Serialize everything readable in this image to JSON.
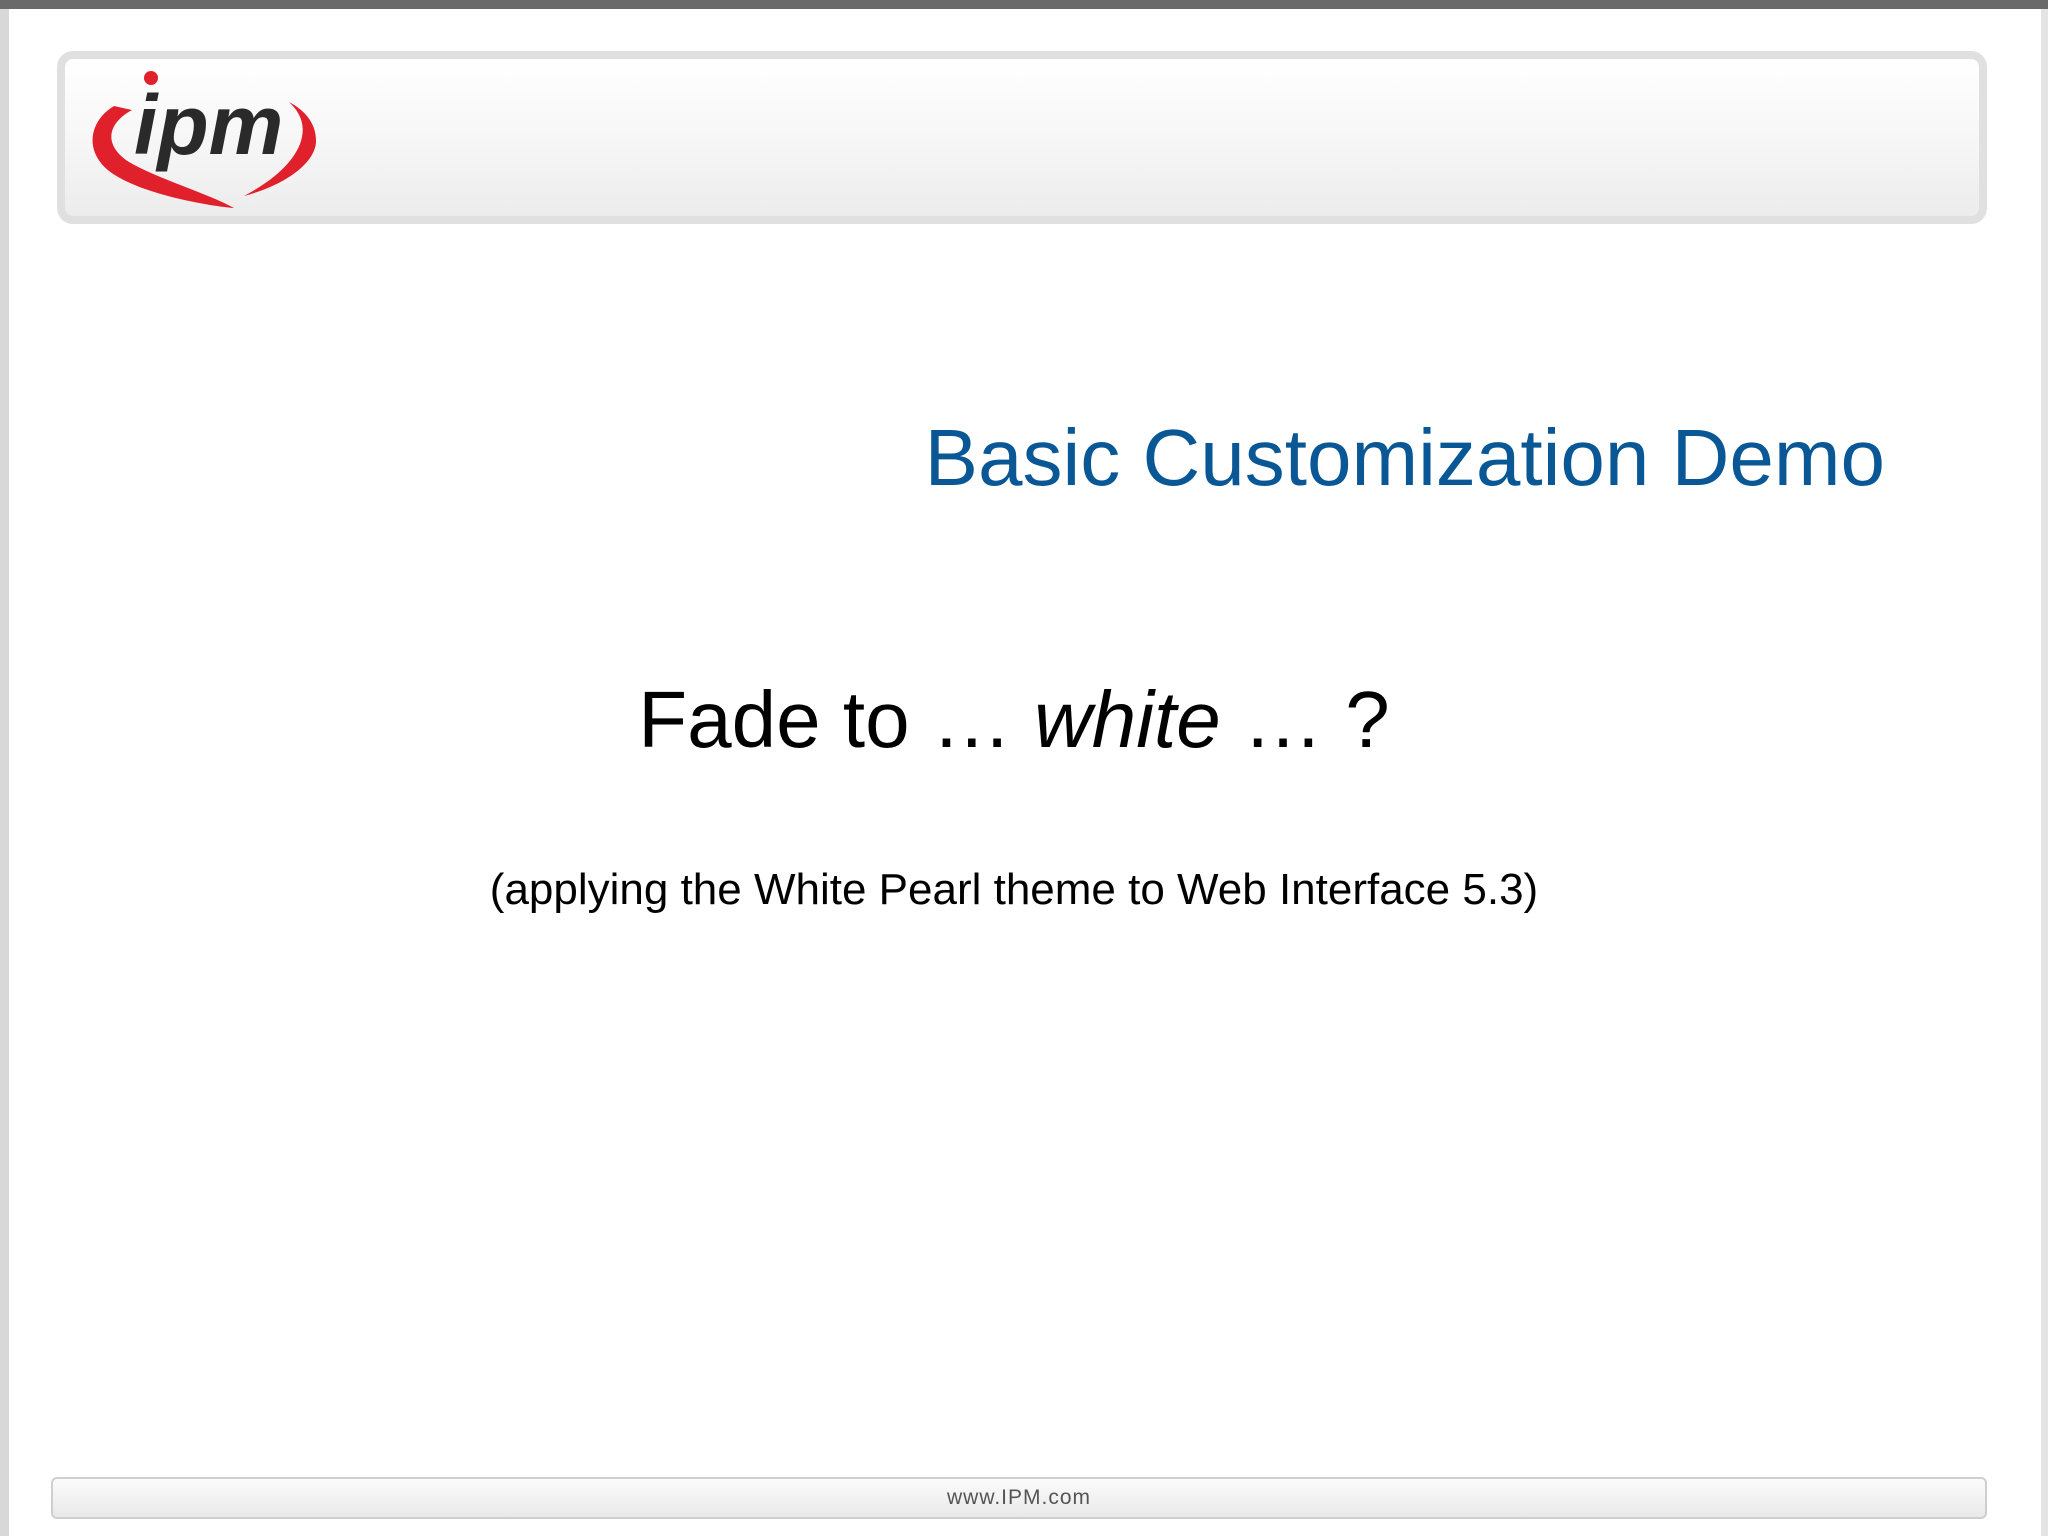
{
  "header": {
    "logo_text": "ipm",
    "logo_icon": "ipm-swoosh-logo"
  },
  "slide": {
    "title": "Basic Customization Demo",
    "subtitle_part1": "Fade to … ",
    "subtitle_emphasis": "white",
    "subtitle_part2": " … ?",
    "caption": "(applying the White Pearl theme to Web Interface 5.3)"
  },
  "footer": {
    "url": "www.IPM.com"
  },
  "colors": {
    "title": "#0a5796",
    "logo_red": "#e0202a",
    "logo_dark": "#2a2a2a"
  }
}
